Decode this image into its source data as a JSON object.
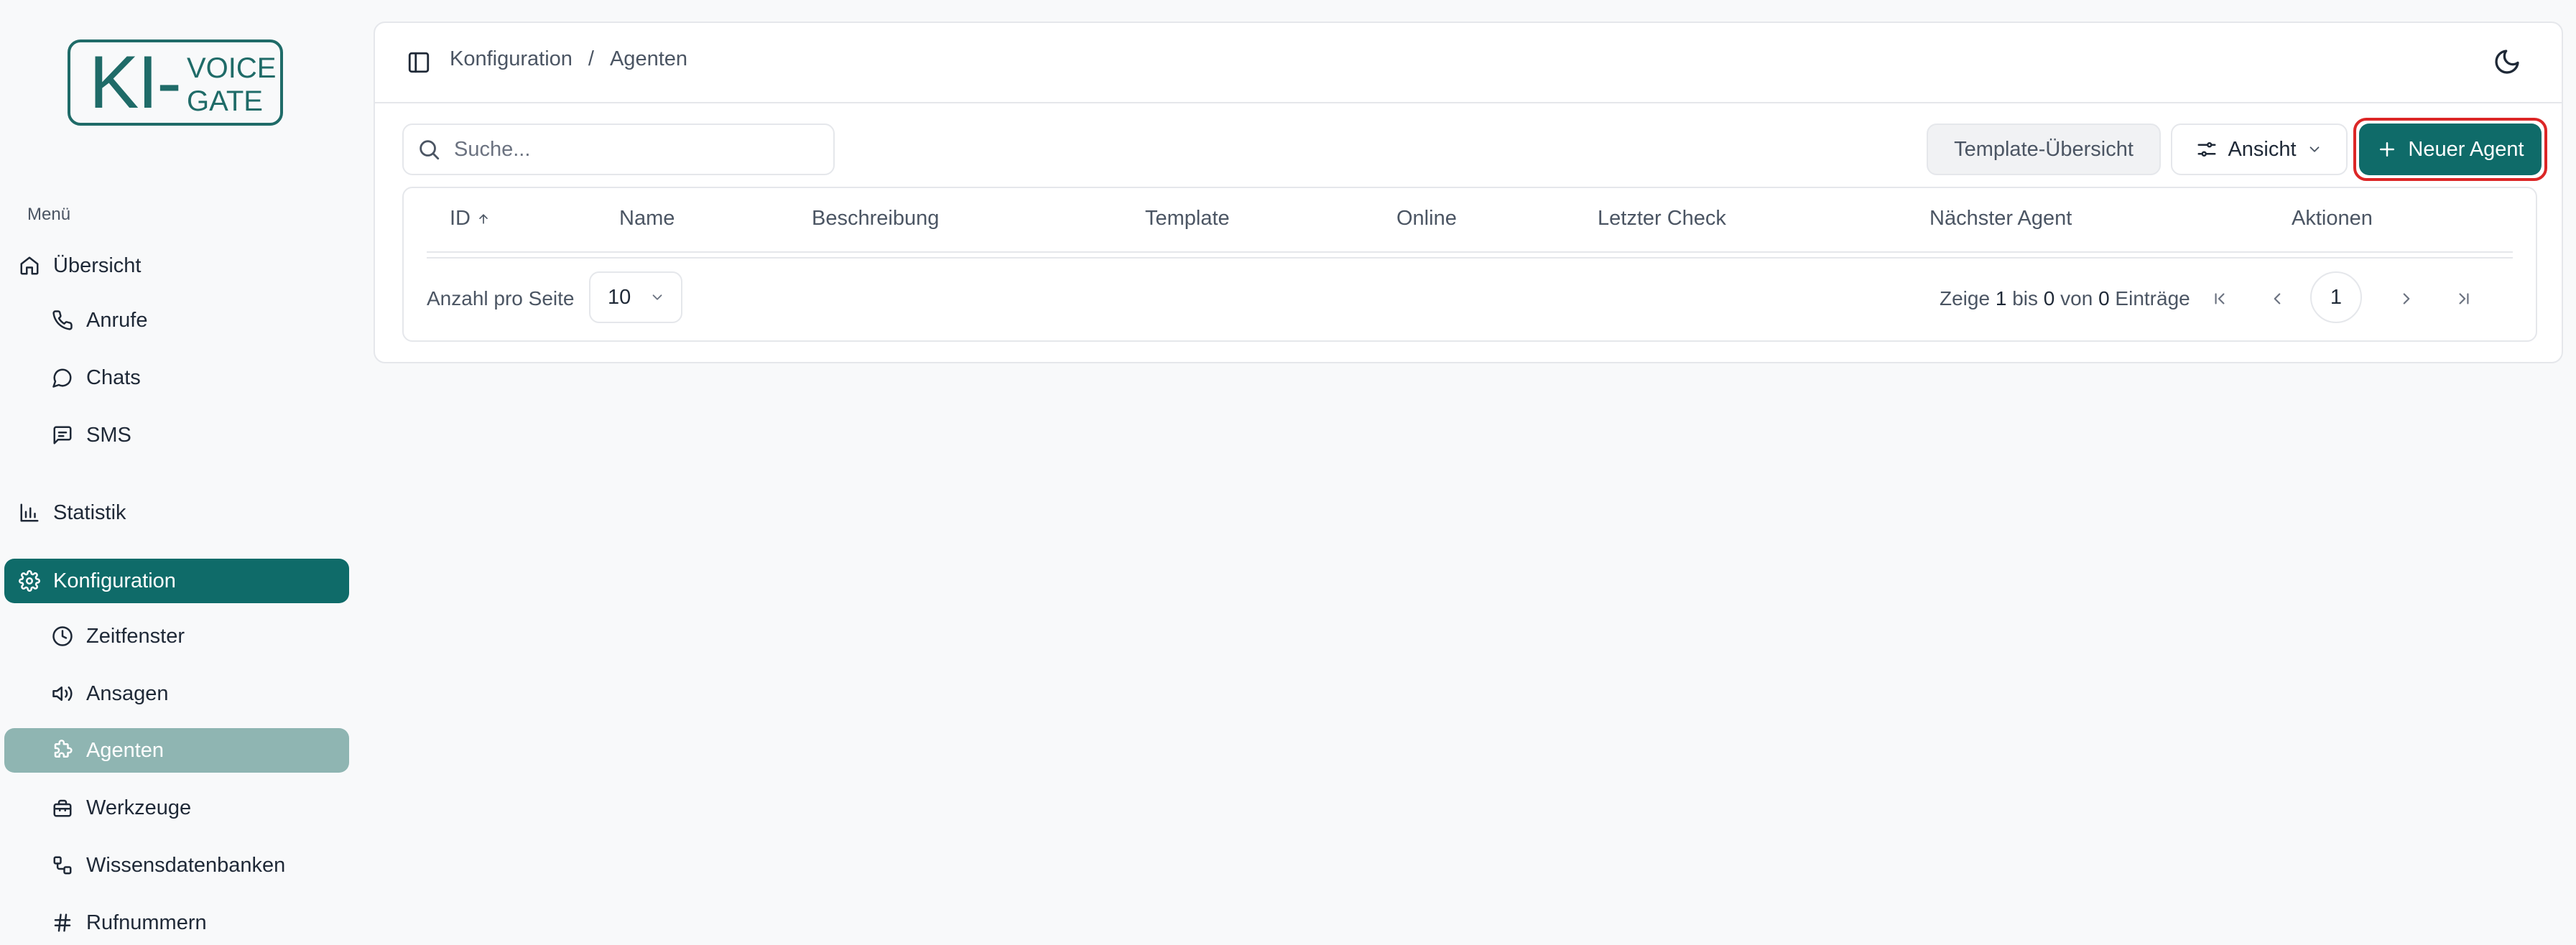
{
  "logo": {
    "main": "KI-",
    "line1": "VOICE",
    "line2": "GATE"
  },
  "sidebar": {
    "menu_label": "Menü",
    "items": [
      {
        "label": "Übersicht",
        "icon": "home-icon"
      },
      {
        "label": "Anrufe",
        "icon": "phone-icon"
      },
      {
        "label": "Chats",
        "icon": "chat-bubble-icon"
      },
      {
        "label": "SMS",
        "icon": "message-square-icon"
      },
      {
        "label": "Statistik",
        "icon": "bar-chart-icon"
      },
      {
        "label": "Konfiguration",
        "icon": "gear-icon"
      },
      {
        "label": "Zeitfenster",
        "icon": "clock-icon"
      },
      {
        "label": "Ansagen",
        "icon": "speaker-icon"
      },
      {
        "label": "Agenten",
        "icon": "puzzle-icon"
      },
      {
        "label": "Werkzeuge",
        "icon": "toolbox-icon"
      },
      {
        "label": "Wissensdatenbanken",
        "icon": "network-icon"
      },
      {
        "label": "Rufnummern",
        "icon": "hash-icon"
      }
    ]
  },
  "topbar": {
    "breadcrumb": {
      "parent": "Konfiguration",
      "separator": "/",
      "current": "Agenten"
    }
  },
  "toolbar": {
    "search_placeholder": "Suche...",
    "template_label": "Template-Übersicht",
    "view_label": "Ansicht",
    "new_label": "Neuer Agent"
  },
  "table": {
    "columns": [
      "ID",
      "Name",
      "Beschreibung",
      "Template",
      "Online",
      "Letzter Check",
      "Nächster Agent",
      "Aktionen"
    ],
    "rows": []
  },
  "pagination": {
    "per_page_label": "Anzahl pro Seite",
    "per_page_value": "10",
    "entries": {
      "w1": "Zeige",
      "from": "1",
      "w2": "bis",
      "to": "0",
      "w3": "von",
      "total": "0",
      "w4": "Einträge"
    },
    "current_page": "1"
  },
  "colors": {
    "primary": "#0f6b69",
    "selected": "#8fb5b2",
    "highlight": "#dc2626"
  }
}
